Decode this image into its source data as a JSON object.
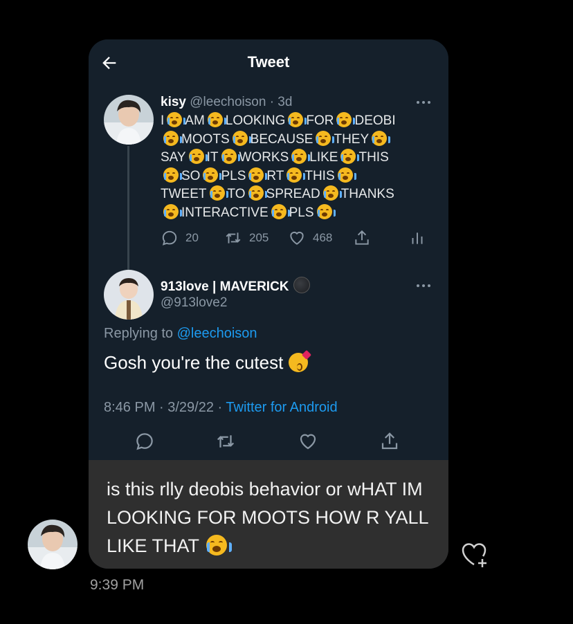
{
  "tweet_header": {
    "title": "Tweet"
  },
  "quoted_tweet": {
    "name": "kisy",
    "handle": "@leechoison",
    "age": "· 3d",
    "lines": [
      [
        "I",
        "AM",
        "LOOKING",
        "FOR",
        "DEOBI"
      ],
      [
        "MOOTS",
        "BECAUSE",
        "THEY"
      ],
      [
        "SAY",
        "IT",
        "WORKS",
        "LIKE",
        "THIS"
      ],
      [
        "SO",
        "PLS",
        "RT",
        "THIS"
      ],
      [
        "TWEET",
        "TO",
        "SPREAD",
        "THANKS"
      ],
      [
        "INTERACTIVE",
        "PLS"
      ]
    ],
    "replies": "20",
    "retweets": "205",
    "likes": "468"
  },
  "reply_tweet": {
    "name": "913love | MAVERICK",
    "handle": "@913love2",
    "replying_prefix": "Replying to ",
    "replying_to": "@leechoison",
    "text": "Gosh you're the cutest",
    "time": "8:46 PM · 3/29/22 · ",
    "source": "Twitter for Android"
  },
  "message": {
    "text": "is this rlly deobis behavior or wHAT IM LOOKING FOR MOOTS HOW R YALL LIKE THAT",
    "time": "9:39 PM"
  },
  "colors": {
    "background": "#000000",
    "tweet_bg": "#15202b",
    "message_bg": "#2f2f2f",
    "link": "#1d9bf0",
    "muted": "#8b98a5"
  },
  "icons": [
    "back-arrow-icon",
    "more-icon",
    "reply-icon",
    "retweet-icon",
    "like-icon",
    "share-icon",
    "analytics-icon",
    "crying-emoji-icon",
    "kiss-emoji-icon",
    "moon-emoji-icon",
    "heart-add-icon"
  ]
}
